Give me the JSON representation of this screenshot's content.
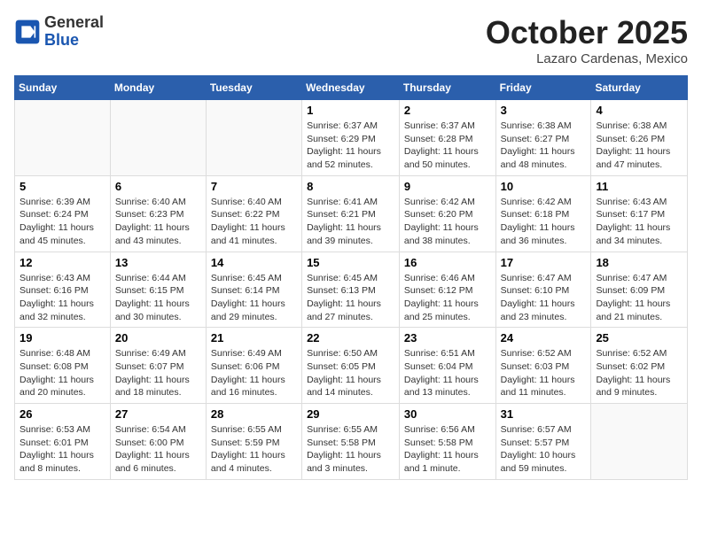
{
  "header": {
    "logo_general": "General",
    "logo_blue": "Blue",
    "month": "October 2025",
    "location": "Lazaro Cardenas, Mexico"
  },
  "weekdays": [
    "Sunday",
    "Monday",
    "Tuesday",
    "Wednesday",
    "Thursday",
    "Friday",
    "Saturday"
  ],
  "weeks": [
    [
      {
        "day": "",
        "detail": ""
      },
      {
        "day": "",
        "detail": ""
      },
      {
        "day": "",
        "detail": ""
      },
      {
        "day": "1",
        "detail": "Sunrise: 6:37 AM\nSunset: 6:29 PM\nDaylight: 11 hours\nand 52 minutes."
      },
      {
        "day": "2",
        "detail": "Sunrise: 6:37 AM\nSunset: 6:28 PM\nDaylight: 11 hours\nand 50 minutes."
      },
      {
        "day": "3",
        "detail": "Sunrise: 6:38 AM\nSunset: 6:27 PM\nDaylight: 11 hours\nand 48 minutes."
      },
      {
        "day": "4",
        "detail": "Sunrise: 6:38 AM\nSunset: 6:26 PM\nDaylight: 11 hours\nand 47 minutes."
      }
    ],
    [
      {
        "day": "5",
        "detail": "Sunrise: 6:39 AM\nSunset: 6:24 PM\nDaylight: 11 hours\nand 45 minutes."
      },
      {
        "day": "6",
        "detail": "Sunrise: 6:40 AM\nSunset: 6:23 PM\nDaylight: 11 hours\nand 43 minutes."
      },
      {
        "day": "7",
        "detail": "Sunrise: 6:40 AM\nSunset: 6:22 PM\nDaylight: 11 hours\nand 41 minutes."
      },
      {
        "day": "8",
        "detail": "Sunrise: 6:41 AM\nSunset: 6:21 PM\nDaylight: 11 hours\nand 39 minutes."
      },
      {
        "day": "9",
        "detail": "Sunrise: 6:42 AM\nSunset: 6:20 PM\nDaylight: 11 hours\nand 38 minutes."
      },
      {
        "day": "10",
        "detail": "Sunrise: 6:42 AM\nSunset: 6:18 PM\nDaylight: 11 hours\nand 36 minutes."
      },
      {
        "day": "11",
        "detail": "Sunrise: 6:43 AM\nSunset: 6:17 PM\nDaylight: 11 hours\nand 34 minutes."
      }
    ],
    [
      {
        "day": "12",
        "detail": "Sunrise: 6:43 AM\nSunset: 6:16 PM\nDaylight: 11 hours\nand 32 minutes."
      },
      {
        "day": "13",
        "detail": "Sunrise: 6:44 AM\nSunset: 6:15 PM\nDaylight: 11 hours\nand 30 minutes."
      },
      {
        "day": "14",
        "detail": "Sunrise: 6:45 AM\nSunset: 6:14 PM\nDaylight: 11 hours\nand 29 minutes."
      },
      {
        "day": "15",
        "detail": "Sunrise: 6:45 AM\nSunset: 6:13 PM\nDaylight: 11 hours\nand 27 minutes."
      },
      {
        "day": "16",
        "detail": "Sunrise: 6:46 AM\nSunset: 6:12 PM\nDaylight: 11 hours\nand 25 minutes."
      },
      {
        "day": "17",
        "detail": "Sunrise: 6:47 AM\nSunset: 6:10 PM\nDaylight: 11 hours\nand 23 minutes."
      },
      {
        "day": "18",
        "detail": "Sunrise: 6:47 AM\nSunset: 6:09 PM\nDaylight: 11 hours\nand 21 minutes."
      }
    ],
    [
      {
        "day": "19",
        "detail": "Sunrise: 6:48 AM\nSunset: 6:08 PM\nDaylight: 11 hours\nand 20 minutes."
      },
      {
        "day": "20",
        "detail": "Sunrise: 6:49 AM\nSunset: 6:07 PM\nDaylight: 11 hours\nand 18 minutes."
      },
      {
        "day": "21",
        "detail": "Sunrise: 6:49 AM\nSunset: 6:06 PM\nDaylight: 11 hours\nand 16 minutes."
      },
      {
        "day": "22",
        "detail": "Sunrise: 6:50 AM\nSunset: 6:05 PM\nDaylight: 11 hours\nand 14 minutes."
      },
      {
        "day": "23",
        "detail": "Sunrise: 6:51 AM\nSunset: 6:04 PM\nDaylight: 11 hours\nand 13 minutes."
      },
      {
        "day": "24",
        "detail": "Sunrise: 6:52 AM\nSunset: 6:03 PM\nDaylight: 11 hours\nand 11 minutes."
      },
      {
        "day": "25",
        "detail": "Sunrise: 6:52 AM\nSunset: 6:02 PM\nDaylight: 11 hours\nand 9 minutes."
      }
    ],
    [
      {
        "day": "26",
        "detail": "Sunrise: 6:53 AM\nSunset: 6:01 PM\nDaylight: 11 hours\nand 8 minutes."
      },
      {
        "day": "27",
        "detail": "Sunrise: 6:54 AM\nSunset: 6:00 PM\nDaylight: 11 hours\nand 6 minutes."
      },
      {
        "day": "28",
        "detail": "Sunrise: 6:55 AM\nSunset: 5:59 PM\nDaylight: 11 hours\nand 4 minutes."
      },
      {
        "day": "29",
        "detail": "Sunrise: 6:55 AM\nSunset: 5:58 PM\nDaylight: 11 hours\nand 3 minutes."
      },
      {
        "day": "30",
        "detail": "Sunrise: 6:56 AM\nSunset: 5:58 PM\nDaylight: 11 hours\nand 1 minute."
      },
      {
        "day": "31",
        "detail": "Sunrise: 6:57 AM\nSunset: 5:57 PM\nDaylight: 10 hours\nand 59 minutes."
      },
      {
        "day": "",
        "detail": ""
      }
    ]
  ]
}
